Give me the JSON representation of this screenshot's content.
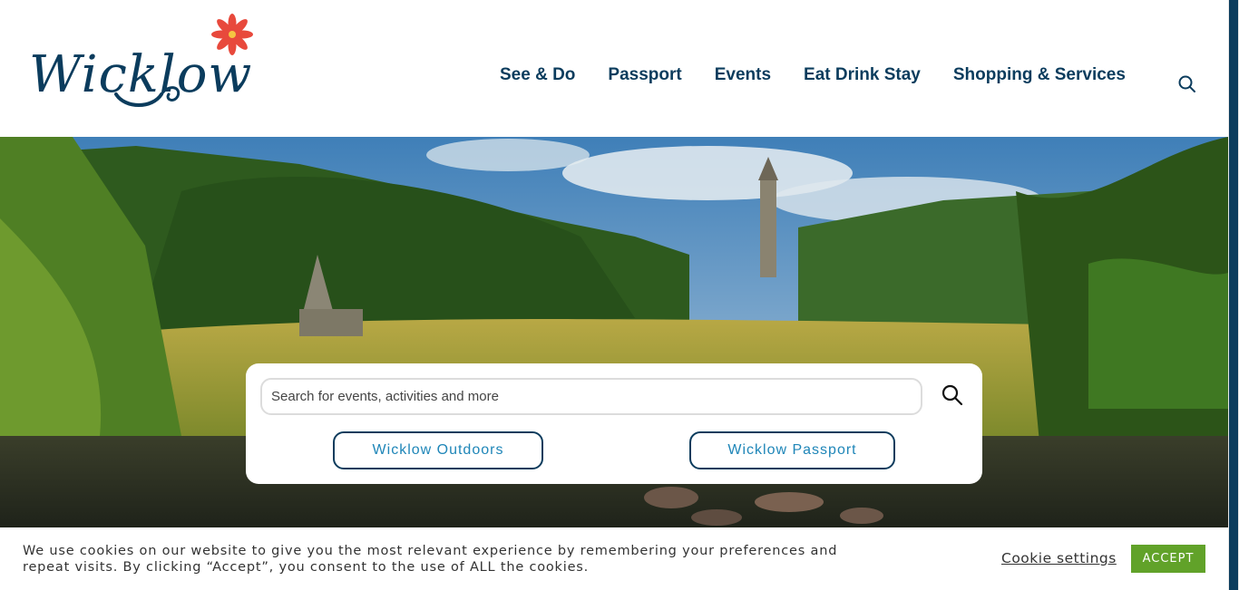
{
  "logo": {
    "text": "Wicklow"
  },
  "nav": {
    "items": [
      {
        "label": "See & Do"
      },
      {
        "label": "Passport"
      },
      {
        "label": "Events"
      },
      {
        "label": "Eat Drink Stay"
      },
      {
        "label": "Shopping & Services"
      }
    ]
  },
  "hero_search": {
    "placeholder": "Search for events, activities and more",
    "value": "",
    "buttons": [
      {
        "label": "Wicklow Outdoors"
      },
      {
        "label": "Wicklow Passport"
      }
    ]
  },
  "cookie_banner": {
    "message": "We use cookies on our website to give you the most relevant experience by remembering your preferences and repeat visits. By clicking “Accept”, you consent to the use of ALL the cookies.",
    "settings_label": "Cookie settings",
    "accept_label": "ACCEPT"
  },
  "colors": {
    "brand_navy": "#0b3c5d",
    "link_blue": "#1f86b8",
    "accept_green": "#61a229",
    "flower_red": "#e8493c"
  },
  "icons": {
    "header_search": "search-icon",
    "hero_search": "search-icon",
    "logo_flower": "flower-icon"
  }
}
